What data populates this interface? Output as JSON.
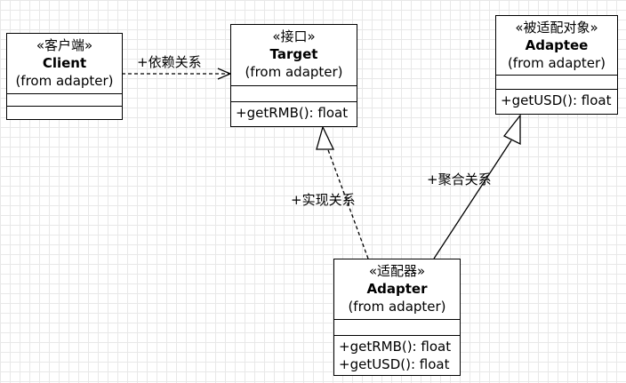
{
  "classes": {
    "client": {
      "stereotype": "«客户端»",
      "name": "Client",
      "package": "(from adapter)",
      "operations": []
    },
    "target": {
      "stereotype": "«接口»",
      "name": "Target",
      "package": "(from adapter)",
      "operations": [
        "+getRMB(): float"
      ]
    },
    "adaptee": {
      "stereotype": "«被适配对象»",
      "name": "Adaptee",
      "package": "(from adapter)",
      "operations": [
        "+getUSD(): float"
      ]
    },
    "adapter": {
      "stereotype": "«适配器»",
      "name": "Adapter",
      "package": "(from adapter)",
      "operations": [
        "+getRMB(): float",
        "+getUSD(): float"
      ]
    }
  },
  "relations": {
    "dependency": "+依赖关系",
    "realization": "+实现关系",
    "aggregation": "+聚合关系"
  }
}
